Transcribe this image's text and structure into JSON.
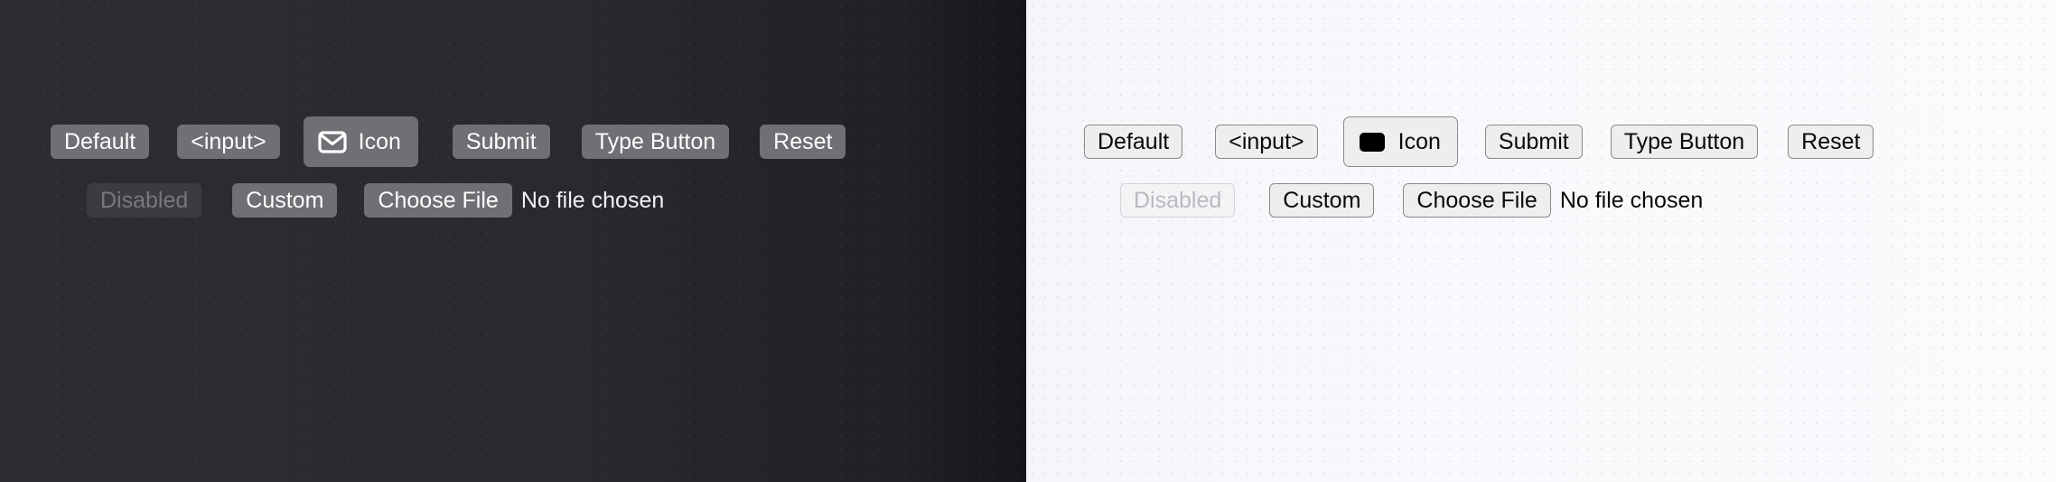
{
  "panels": [
    {
      "theme": "dark",
      "background_color": "#282a2e",
      "button_fill": "#6e7074",
      "button_text_color": "#ffffff",
      "disabled_fill": "#3a3c41",
      "disabled_text_color": "#78797d",
      "row1": {
        "default_label": "Default",
        "input_label": "<input>",
        "icon_label": "Icon",
        "icon_name": "envelope-icon",
        "icon_style": "outline",
        "submit_label": "Submit",
        "type_button_label": "Type Button",
        "reset_label": "Reset"
      },
      "row2": {
        "disabled_label": "Disabled",
        "custom_label": "Custom",
        "choose_file_label": "Choose File",
        "file_status": "No file chosen"
      }
    },
    {
      "theme": "light",
      "background_color": "#f7f8fb",
      "button_fill": "#eeeeee",
      "button_text_color": "#0a0a0a",
      "button_border_color": "#8a8a8a",
      "disabled_text_color": "#b9babd",
      "row1": {
        "default_label": "Default",
        "input_label": "<input>",
        "icon_label": "Icon",
        "icon_name": "envelope-icon",
        "icon_style": "solid",
        "submit_label": "Submit",
        "type_button_label": "Type Button",
        "reset_label": "Reset"
      },
      "row2": {
        "disabled_label": "Disabled",
        "custom_label": "Custom",
        "choose_file_label": "Choose File",
        "file_status": "No file chosen"
      }
    }
  ]
}
